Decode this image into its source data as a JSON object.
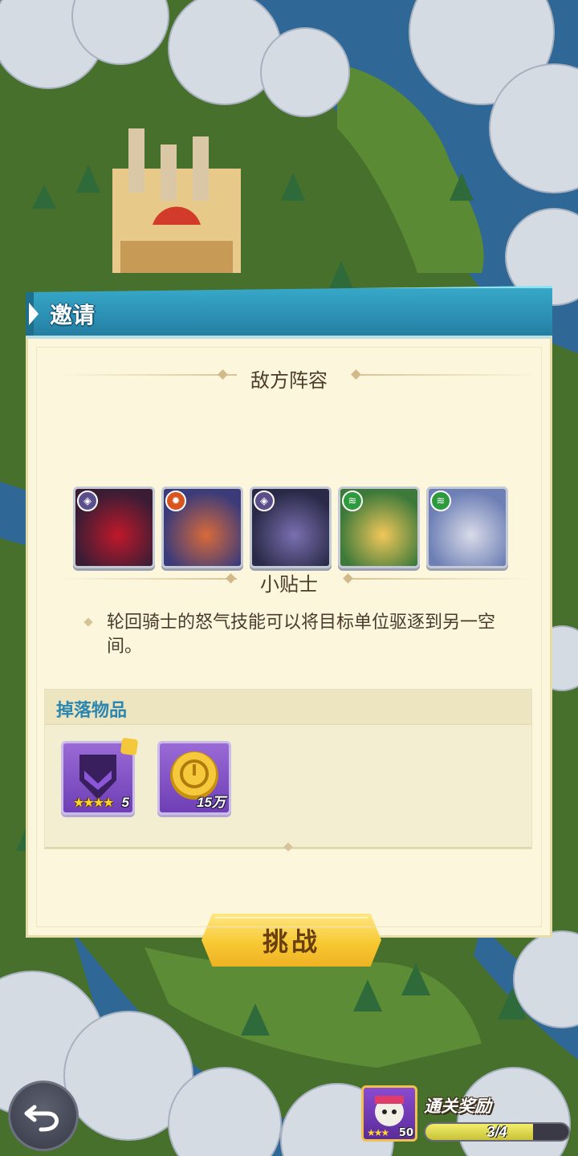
{
  "dialog": {
    "title": "邀请",
    "enemy_section_title": "敌方阵容",
    "tips_section_title": "小贴士",
    "tip_text": "轮回骑士的怒气技能可以将目标单位驱逐到另一空间。",
    "drops_title": "掉落物品",
    "challenge_button": "挑战"
  },
  "enemies": [
    {
      "name": "skull-knight-hero",
      "faction": "void",
      "faction_color": "#5a4f8a",
      "portrait_colors": [
        "#3a1d35",
        "#c0182a"
      ]
    },
    {
      "name": "demon-warrior-hero",
      "faction": "fire",
      "faction_color": "#d9541e",
      "portrait_colors": [
        "#3b3b7a",
        "#d86a3a"
      ]
    },
    {
      "name": "dark-gunslinger-hero",
      "faction": "void",
      "faction_color": "#5a4f8a",
      "portrait_colors": [
        "#2a2a48",
        "#7a6fb0"
      ]
    },
    {
      "name": "hooded-girl-hero",
      "faction": "wind",
      "faction_color": "#2e9a3e",
      "portrait_colors": [
        "#3d7a3a",
        "#f2c75a"
      ]
    },
    {
      "name": "white-hair-elf-hero",
      "faction": "wind",
      "faction_color": "#2e9a3e",
      "portrait_colors": [
        "#6d7fb5",
        "#d9dbe8"
      ]
    }
  ],
  "drops": [
    {
      "name": "hero-fragment",
      "count": "5",
      "stars": "★★★★",
      "icon": "dark-helmet-icon"
    },
    {
      "name": "gold-coin",
      "count": "15万",
      "icon": "gold-coin-icon"
    }
  ],
  "hud": {
    "reward_title": "通关奖励",
    "reward_level": "50",
    "reward_stars": "★★★",
    "reward_progress_text": "3/4",
    "reward_progress": 0.75
  }
}
